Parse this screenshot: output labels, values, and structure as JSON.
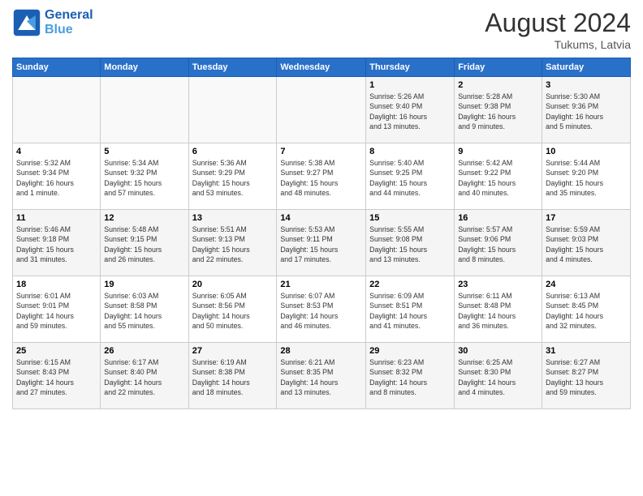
{
  "header": {
    "logo_line1": "General",
    "logo_line2": "Blue",
    "month_year": "August 2024",
    "location": "Tukums, Latvia"
  },
  "weekdays": [
    "Sunday",
    "Monday",
    "Tuesday",
    "Wednesday",
    "Thursday",
    "Friday",
    "Saturday"
  ],
  "weeks": [
    [
      {
        "day": "",
        "info": ""
      },
      {
        "day": "",
        "info": ""
      },
      {
        "day": "",
        "info": ""
      },
      {
        "day": "",
        "info": ""
      },
      {
        "day": "1",
        "info": "Sunrise: 5:26 AM\nSunset: 9:40 PM\nDaylight: 16 hours\nand 13 minutes."
      },
      {
        "day": "2",
        "info": "Sunrise: 5:28 AM\nSunset: 9:38 PM\nDaylight: 16 hours\nand 9 minutes."
      },
      {
        "day": "3",
        "info": "Sunrise: 5:30 AM\nSunset: 9:36 PM\nDaylight: 16 hours\nand 5 minutes."
      }
    ],
    [
      {
        "day": "4",
        "info": "Sunrise: 5:32 AM\nSunset: 9:34 PM\nDaylight: 16 hours\nand 1 minute."
      },
      {
        "day": "5",
        "info": "Sunrise: 5:34 AM\nSunset: 9:32 PM\nDaylight: 15 hours\nand 57 minutes."
      },
      {
        "day": "6",
        "info": "Sunrise: 5:36 AM\nSunset: 9:29 PM\nDaylight: 15 hours\nand 53 minutes."
      },
      {
        "day": "7",
        "info": "Sunrise: 5:38 AM\nSunset: 9:27 PM\nDaylight: 15 hours\nand 48 minutes."
      },
      {
        "day": "8",
        "info": "Sunrise: 5:40 AM\nSunset: 9:25 PM\nDaylight: 15 hours\nand 44 minutes."
      },
      {
        "day": "9",
        "info": "Sunrise: 5:42 AM\nSunset: 9:22 PM\nDaylight: 15 hours\nand 40 minutes."
      },
      {
        "day": "10",
        "info": "Sunrise: 5:44 AM\nSunset: 9:20 PM\nDaylight: 15 hours\nand 35 minutes."
      }
    ],
    [
      {
        "day": "11",
        "info": "Sunrise: 5:46 AM\nSunset: 9:18 PM\nDaylight: 15 hours\nand 31 minutes."
      },
      {
        "day": "12",
        "info": "Sunrise: 5:48 AM\nSunset: 9:15 PM\nDaylight: 15 hours\nand 26 minutes."
      },
      {
        "day": "13",
        "info": "Sunrise: 5:51 AM\nSunset: 9:13 PM\nDaylight: 15 hours\nand 22 minutes."
      },
      {
        "day": "14",
        "info": "Sunrise: 5:53 AM\nSunset: 9:11 PM\nDaylight: 15 hours\nand 17 minutes."
      },
      {
        "day": "15",
        "info": "Sunrise: 5:55 AM\nSunset: 9:08 PM\nDaylight: 15 hours\nand 13 minutes."
      },
      {
        "day": "16",
        "info": "Sunrise: 5:57 AM\nSunset: 9:06 PM\nDaylight: 15 hours\nand 8 minutes."
      },
      {
        "day": "17",
        "info": "Sunrise: 5:59 AM\nSunset: 9:03 PM\nDaylight: 15 hours\nand 4 minutes."
      }
    ],
    [
      {
        "day": "18",
        "info": "Sunrise: 6:01 AM\nSunset: 9:01 PM\nDaylight: 14 hours\nand 59 minutes."
      },
      {
        "day": "19",
        "info": "Sunrise: 6:03 AM\nSunset: 8:58 PM\nDaylight: 14 hours\nand 55 minutes."
      },
      {
        "day": "20",
        "info": "Sunrise: 6:05 AM\nSunset: 8:56 PM\nDaylight: 14 hours\nand 50 minutes."
      },
      {
        "day": "21",
        "info": "Sunrise: 6:07 AM\nSunset: 8:53 PM\nDaylight: 14 hours\nand 46 minutes."
      },
      {
        "day": "22",
        "info": "Sunrise: 6:09 AM\nSunset: 8:51 PM\nDaylight: 14 hours\nand 41 minutes."
      },
      {
        "day": "23",
        "info": "Sunrise: 6:11 AM\nSunset: 8:48 PM\nDaylight: 14 hours\nand 36 minutes."
      },
      {
        "day": "24",
        "info": "Sunrise: 6:13 AM\nSunset: 8:45 PM\nDaylight: 14 hours\nand 32 minutes."
      }
    ],
    [
      {
        "day": "25",
        "info": "Sunrise: 6:15 AM\nSunset: 8:43 PM\nDaylight: 14 hours\nand 27 minutes."
      },
      {
        "day": "26",
        "info": "Sunrise: 6:17 AM\nSunset: 8:40 PM\nDaylight: 14 hours\nand 22 minutes."
      },
      {
        "day": "27",
        "info": "Sunrise: 6:19 AM\nSunset: 8:38 PM\nDaylight: 14 hours\nand 18 minutes."
      },
      {
        "day": "28",
        "info": "Sunrise: 6:21 AM\nSunset: 8:35 PM\nDaylight: 14 hours\nand 13 minutes."
      },
      {
        "day": "29",
        "info": "Sunrise: 6:23 AM\nSunset: 8:32 PM\nDaylight: 14 hours\nand 8 minutes."
      },
      {
        "day": "30",
        "info": "Sunrise: 6:25 AM\nSunset: 8:30 PM\nDaylight: 14 hours\nand 4 minutes."
      },
      {
        "day": "31",
        "info": "Sunrise: 6:27 AM\nSunset: 8:27 PM\nDaylight: 13 hours\nand 59 minutes."
      }
    ]
  ]
}
